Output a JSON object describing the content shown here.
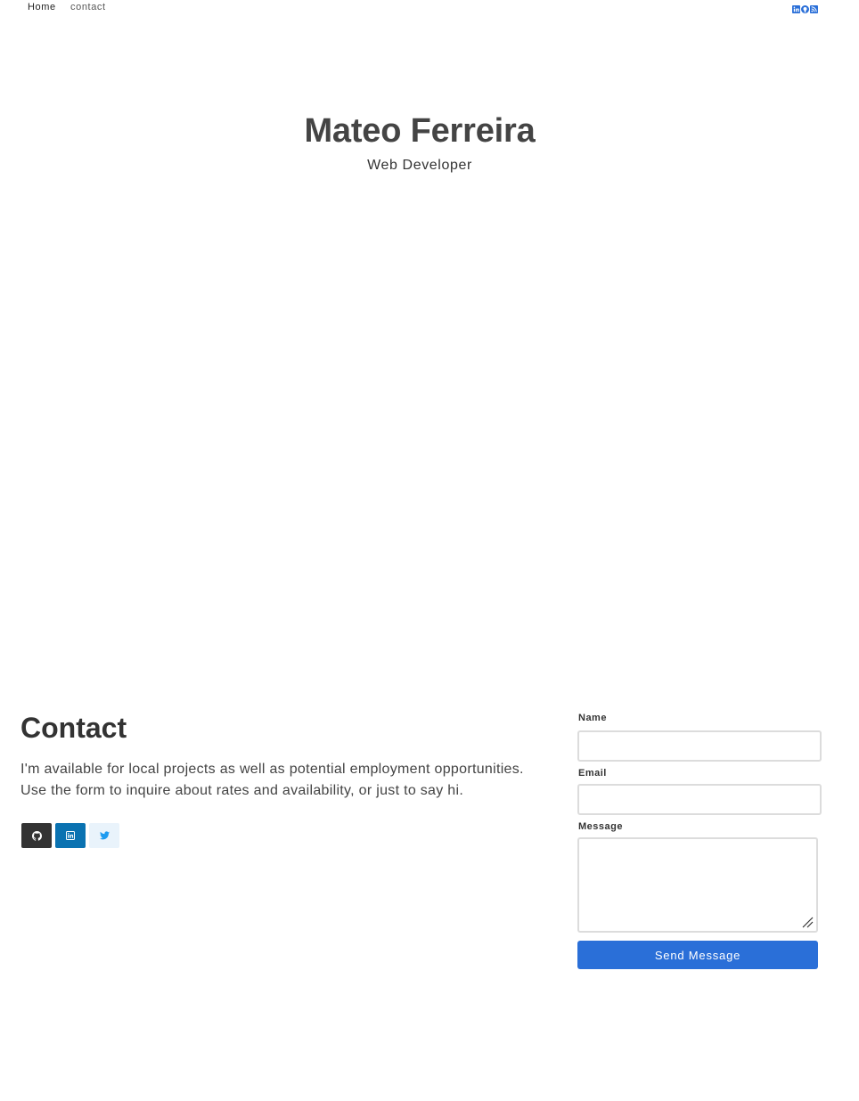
{
  "nav": {
    "home": "Home",
    "contact": "contact"
  },
  "header_social": [
    "linkedin-icon",
    "github-icon",
    "rss-icon"
  ],
  "hero": {
    "name": "Mateo Ferreira",
    "role": "Web Developer"
  },
  "contact": {
    "heading": "Contact",
    "text": "I'm available for local projects as well as potential employment opportunities. Use the form to inquire about rates and availability, or just to say hi.",
    "buttons": [
      "github-icon",
      "linkedin-icon",
      "twitter-icon"
    ]
  },
  "form": {
    "name_label": "Name",
    "email_label": "Email",
    "message_label": "Message",
    "name_value": "",
    "email_value": "",
    "message_value": "",
    "submit_label": "Send Message"
  },
  "colors": {
    "accent": "#2a6fd8",
    "github": "#333333",
    "linkedin": "#0a72b1",
    "twitter_bg": "#e9f3fb",
    "twitter_fg": "#1d9bf0"
  }
}
